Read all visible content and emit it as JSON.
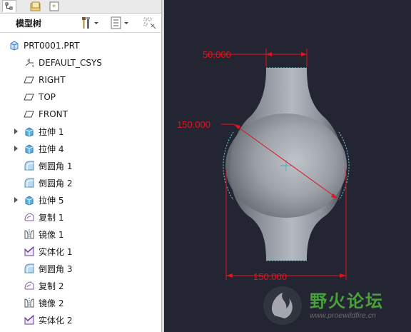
{
  "tree_panel": {
    "title": "模型树",
    "root_label": "PRT0001.PRT",
    "items": [
      {
        "label": "DEFAULT_CSYS",
        "icon": "csys-icon",
        "expandable": false
      },
      {
        "label": "RIGHT",
        "icon": "datum-plane-icon",
        "expandable": false
      },
      {
        "label": "TOP",
        "icon": "datum-plane-icon",
        "expandable": false
      },
      {
        "label": "FRONT",
        "icon": "datum-plane-icon",
        "expandable": false
      },
      {
        "label": "拉伸 1",
        "icon": "extrude-icon",
        "expandable": true
      },
      {
        "label": "拉伸 4",
        "icon": "extrude-icon",
        "expandable": true
      },
      {
        "label": "倒圆角 1",
        "icon": "round-icon",
        "expandable": false
      },
      {
        "label": "倒圆角 2",
        "icon": "round-icon",
        "expandable": false
      },
      {
        "label": "拉伸 5",
        "icon": "extrude-icon",
        "expandable": true
      },
      {
        "label": "复制 1",
        "icon": "copy-icon",
        "expandable": false
      },
      {
        "label": "镜像 1",
        "icon": "mirror-icon",
        "expandable": false
      },
      {
        "label": "实体化 1",
        "icon": "solidify-icon",
        "expandable": false
      },
      {
        "label": "倒圆角 3",
        "icon": "round-icon",
        "expandable": false
      },
      {
        "label": "复制 2",
        "icon": "copy-icon",
        "expandable": false
      },
      {
        "label": "镜像 2",
        "icon": "mirror-icon",
        "expandable": false
      },
      {
        "label": "实体化 2",
        "icon": "solidify-icon",
        "expandable": false
      }
    ]
  },
  "viewport": {
    "dimensions": {
      "top_width": "50.000",
      "diameter": "150.000",
      "bottom_width": "150.000"
    },
    "dimension_color": "#e0141e",
    "background_color": "#232632"
  },
  "watermark": {
    "text": "野火论坛",
    "url": "www.proewildfire.cn"
  }
}
